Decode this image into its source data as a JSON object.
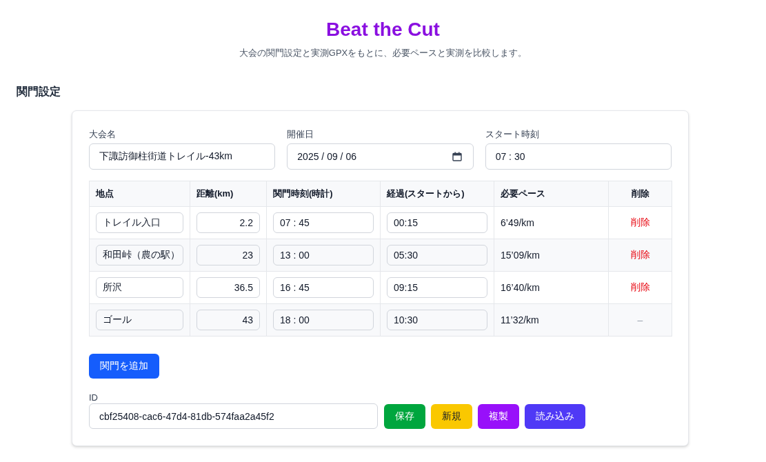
{
  "header": {
    "title": "Beat the Cut",
    "subtitle": "大会の関門設定と実測GPXをもとに、必要ペースと実測を比較します。"
  },
  "section": {
    "heading": "関門設定"
  },
  "form": {
    "fields": [
      {
        "kind": "text",
        "label": "大会名",
        "value": "下諏訪御柱街道トレイル-43km"
      },
      {
        "kind": "date",
        "label": "開催日",
        "value": "2025 / 09 / 06"
      },
      {
        "kind": "time",
        "label": "スタート時刻",
        "value": "07 : 30"
      }
    ]
  },
  "table": {
    "columns": [
      "地点",
      "距離(km)",
      "関門時刻(時計)",
      "経過(スタートから)",
      "必要ペース",
      "削除"
    ],
    "rows": [
      {
        "point": "トレイル入口",
        "distance": "2.2",
        "gate_time": "07 : 45",
        "elapsed": "00:15",
        "pace": "6’49/km",
        "delete": {
          "kind": "button",
          "label": "削除"
        }
      },
      {
        "point": "和田峠（農の駅）",
        "distance": "23",
        "gate_time": "13 : 00",
        "elapsed": "05:30",
        "pace": "15’09/km",
        "delete": {
          "kind": "button",
          "label": "削除"
        }
      },
      {
        "point": "所沢",
        "distance": "36.5",
        "gate_time": "16 : 45",
        "elapsed": "09:15",
        "pace": "16’40/km",
        "delete": {
          "kind": "button",
          "label": "削除"
        }
      },
      {
        "point": "ゴール",
        "distance": "43",
        "gate_time": "18 : 00",
        "elapsed": "10:30",
        "pace": "11’32/km",
        "delete": {
          "kind": "none",
          "label": "–"
        }
      }
    ]
  },
  "add_button": {
    "label": "関門を追加"
  },
  "id_field": {
    "label": "ID",
    "value": "cbf25408-cac6-47d4-81db-574faa2a45f2"
  },
  "actions": [
    {
      "label": "保存",
      "color": "#00a63e"
    },
    {
      "label": "新規",
      "color": "#fac800"
    },
    {
      "label": "複製",
      "color": "#9810fa"
    },
    {
      "label": "読み込み",
      "color": "#4f39f6"
    }
  ]
}
